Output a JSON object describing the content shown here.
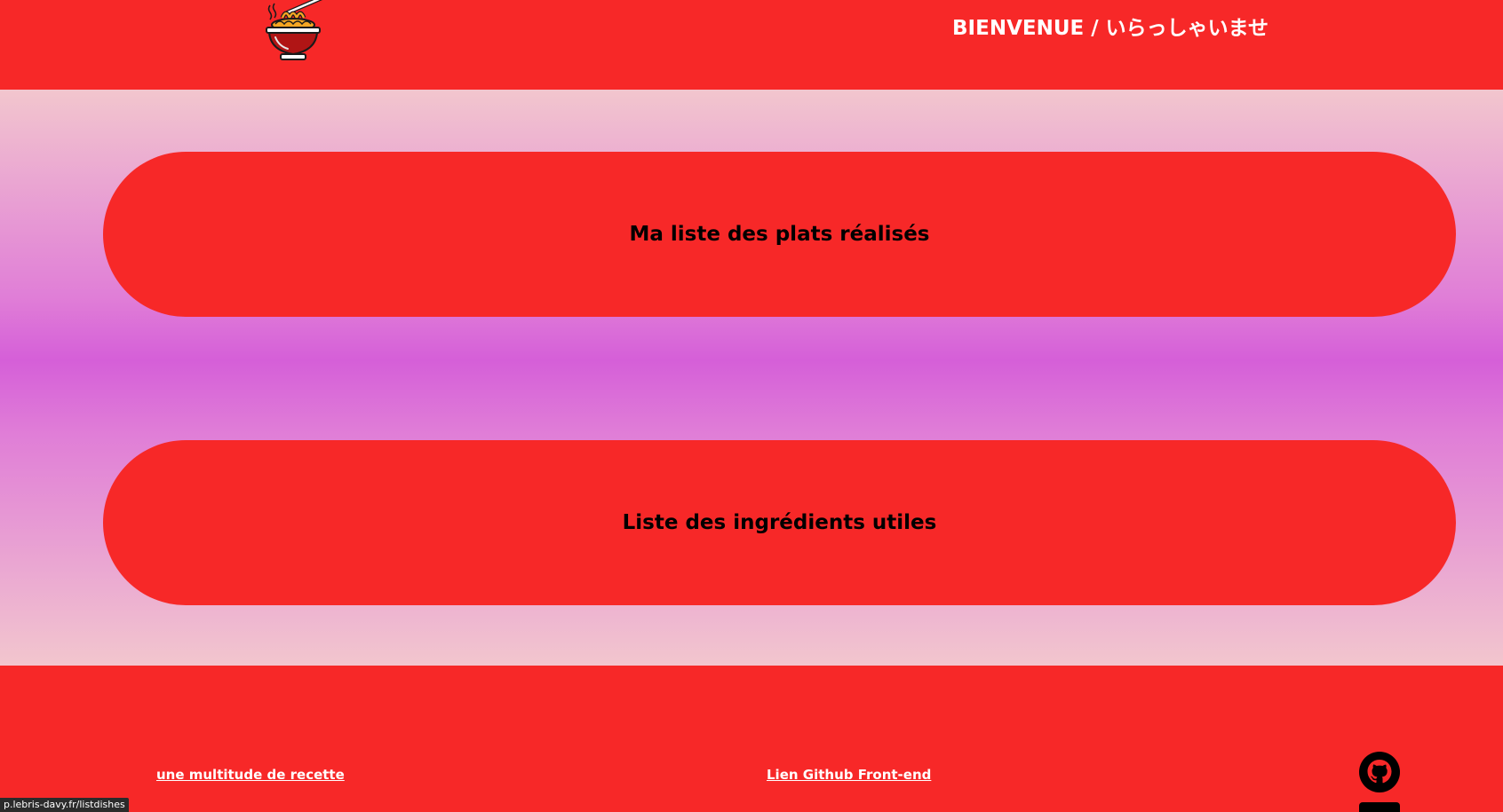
{
  "header": {
    "welcome": "BIENVENUE / いらっしゃいませ",
    "logo_icon": "ramen-bowl-icon"
  },
  "main": {
    "buttons": [
      {
        "label": "Ma liste des plats réalisés"
      },
      {
        "label": "Liste des ingrédients utiles"
      }
    ]
  },
  "footer": {
    "links": [
      {
        "label": "une multitude de recette"
      },
      {
        "label": "Lien Github Front-end"
      }
    ],
    "icons": [
      "github-icon",
      "profile-icon"
    ]
  },
  "status_bar": {
    "url": "p.lebris-davy.fr/listdishes"
  },
  "colors": {
    "primary_red": "#f72828",
    "gradient_light": "#f2c6ce",
    "gradient_purple": "#d55fd8"
  }
}
